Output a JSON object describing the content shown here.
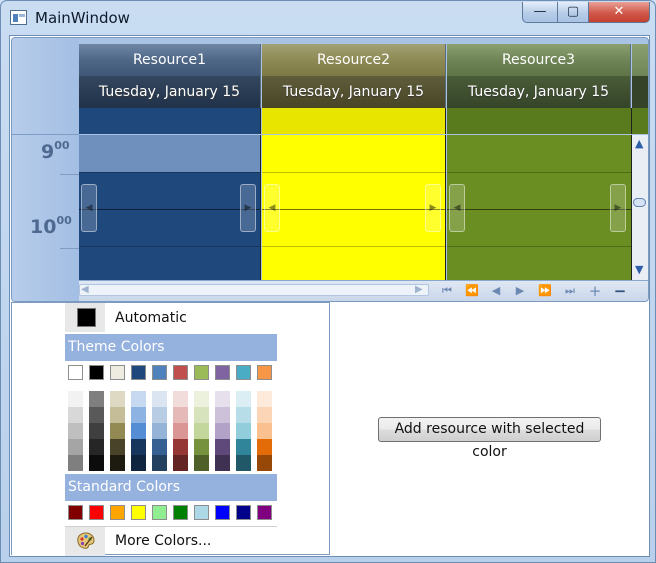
{
  "window": {
    "title": "MainWindow",
    "minimize_glyph": "—",
    "maximize_glyph": "▢",
    "close_glyph": "✕"
  },
  "scheduler": {
    "time_slots": [
      {
        "hour": "9",
        "minutes": "00"
      },
      {
        "hour": "10",
        "minutes": "00"
      }
    ],
    "resources": [
      {
        "name": "Resource1",
        "date": "Tuesday, January 15",
        "color": "#1f497d",
        "header_color": "#4e6787"
      },
      {
        "name": "Resource2",
        "date": "Tuesday, January 15",
        "color": "#ffff00",
        "header_color": "#8d8a55"
      },
      {
        "name": "Resource3",
        "date": "Tuesday, January 15",
        "color": "#6b8e23",
        "header_color": "#6f8557"
      }
    ]
  },
  "color_picker": {
    "automatic_label": "Automatic",
    "automatic_color": "#000000",
    "theme_colors_label": "Theme Colors",
    "theme_colors": [
      "#ffffff",
      "#000000",
      "#eeece1",
      "#1f497d",
      "#4f81bd",
      "#c0504d",
      "#9bbb59",
      "#8064a2",
      "#4bacc6",
      "#f79646"
    ],
    "theme_shades": [
      [
        "#f2f2f2",
        "#d8d8d8",
        "#bfbfbf",
        "#a5a5a5",
        "#7f7f7f"
      ],
      [
        "#7f7f7f",
        "#595959",
        "#3f3f3f",
        "#262626",
        "#0c0c0c"
      ],
      [
        "#ddd9c3",
        "#c4bd97",
        "#938953",
        "#494429",
        "#1d1b10"
      ],
      [
        "#c6d9f0",
        "#8db3e2",
        "#548dd4",
        "#17365d",
        "#0f243e"
      ],
      [
        "#dbe5f1",
        "#b8cce4",
        "#95b3d7",
        "#366092",
        "#244061"
      ],
      [
        "#f2dcdb",
        "#e5b9b7",
        "#d99694",
        "#953734",
        "#632423"
      ],
      [
        "#ebf1dd",
        "#d7e3bc",
        "#c3d69b",
        "#76923c",
        "#4f6128"
      ],
      [
        "#e5e0ec",
        "#ccc1d9",
        "#b2a2c7",
        "#5f497a",
        "#3f3151"
      ],
      [
        "#dbeef3",
        "#b7dde8",
        "#92cddc",
        "#31859b",
        "#205867"
      ],
      [
        "#fdeada",
        "#fbd5b5",
        "#fac08f",
        "#e36c09",
        "#974806"
      ]
    ],
    "standard_colors_label": "Standard Colors",
    "standard_colors": [
      "#800000",
      "#ff0000",
      "#ffa500",
      "#ffff00",
      "#90ee90",
      "#008000",
      "#add8e6",
      "#0000ff",
      "#00008b",
      "#800080"
    ],
    "more_colors_label": "More Colors...",
    "palette_icon": "palette-icon"
  },
  "add_button_label": "Add resource with selected color"
}
